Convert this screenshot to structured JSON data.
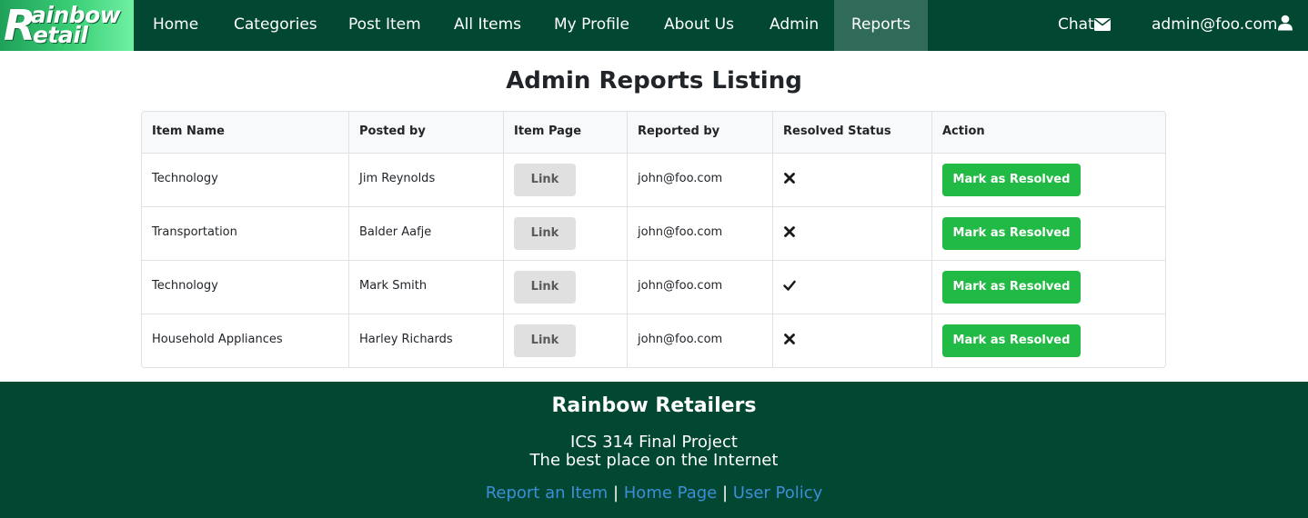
{
  "brand": {
    "line1": "ainbow",
    "line2": "etail",
    "initial": "R"
  },
  "nav": {
    "items": [
      "Home",
      "Categories",
      "Post Item",
      "All Items",
      "My Profile",
      "About Us",
      "Admin",
      "Reports"
    ],
    "active": "Reports",
    "chat_label": "Chat",
    "user_label": "admin@foo.com"
  },
  "main": {
    "title": "Admin Reports Listing",
    "columns": [
      "Item Name",
      "Posted by",
      "Item Page",
      "Reported by",
      "Resolved Status",
      "Action"
    ],
    "rows": [
      {
        "item": "Technology",
        "posted_by": "Jim Reynolds",
        "link": "Link",
        "reported_by": "john@foo.com",
        "resolved": false,
        "action": "Mark as Resolved"
      },
      {
        "item": "Transportation",
        "posted_by": "Balder Aafje",
        "link": "Link",
        "reported_by": "john@foo.com",
        "resolved": false,
        "action": "Mark as Resolved"
      },
      {
        "item": "Technology",
        "posted_by": "Mark Smith",
        "link": "Link",
        "reported_by": "john@foo.com",
        "resolved": true,
        "action": "Mark as Resolved"
      },
      {
        "item": "Household Appliances",
        "posted_by": "Harley Richards",
        "link": "Link",
        "reported_by": "john@foo.com",
        "resolved": false,
        "action": "Mark as Resolved"
      }
    ]
  },
  "footer": {
    "title": "Rainbow Retailers",
    "line1": "ICS 314 Final Project",
    "line2": "The best place on the Internet",
    "links": [
      "Report an Item",
      "Home Page",
      "User Policy"
    ],
    "separator": "|"
  },
  "colors": {
    "nav_bg": "#024731",
    "nav_active": "#2f6b58",
    "resolve_button": "#21ba45",
    "link_button": "#e0e0e0",
    "footer_link": "#3d8ed8"
  },
  "icons": {
    "chat": "envelope-icon",
    "user": "user-icon",
    "unresolved": "x-icon",
    "resolved": "checkmark-icon"
  }
}
